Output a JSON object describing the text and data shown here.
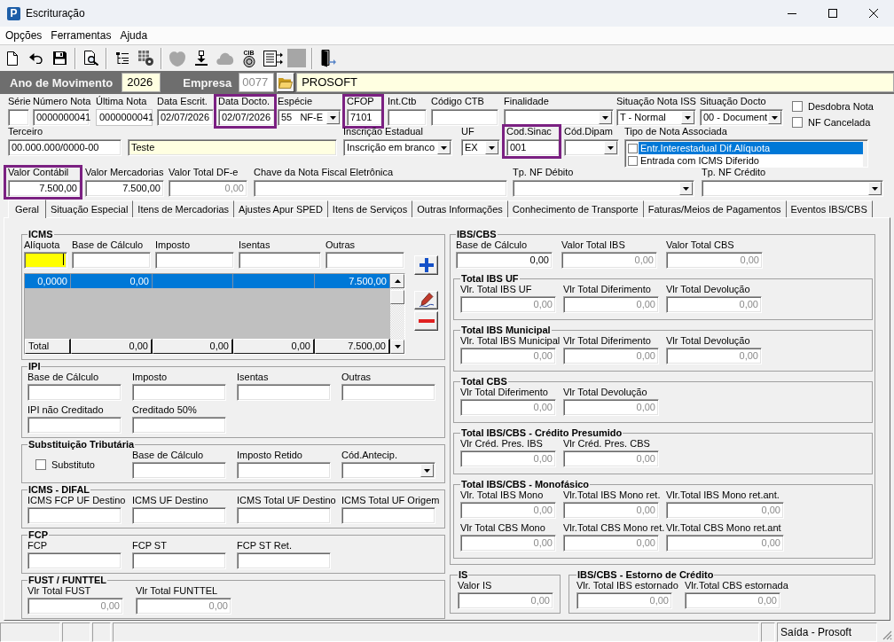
{
  "window": {
    "icon_text": "P",
    "title": "Escrituração"
  },
  "menu": [
    {
      "label": "Opções"
    },
    {
      "label": "Ferramentas"
    },
    {
      "label": "Ajuda"
    }
  ],
  "toolbar": [
    [
      {
        "disabled": false
      },
      {
        "disabled": false
      },
      {
        "disabled": false
      }
    ],
    [
      {
        "disabled": false
      }
    ],
    [
      {
        "disabled": false
      },
      {
        "disabled": false
      }
    ],
    [
      {
        "disabled": true
      },
      {
        "disabled": false
      },
      {
        "disabled": true
      },
      {
        "disabled": false,
        "caption": "CIB"
      },
      {
        "disabled": false
      },
      {
        "disabled": true
      }
    ],
    [
      {
        "disabled": false
      }
    ]
  ],
  "header": {
    "year": {
      "label": "Ano de Movimento",
      "value": "2026",
      "readonly": true
    },
    "company": {
      "label": "Empresa",
      "code": {
        "value": "0077",
        "disabled": true
      },
      "name": {
        "value": "PROSOFT",
        "readonly": true
      }
    }
  },
  "document": {
    "fields": [
      {
        "kind": "text",
        "label": "Série",
        "highlighted": false
      },
      {
        "kind": "text",
        "label": "Número Nota",
        "value": "0000000041",
        "disabled": false,
        "highlighted": false
      },
      {
        "kind": "static",
        "label": "Última Nota",
        "value": "0000000041",
        "disabled": false,
        "highlighted": false
      },
      {
        "kind": "text",
        "label": "Data Escrit.",
        "value": "02/07/2026",
        "disabled": false,
        "highlighted": false
      },
      {
        "kind": "text",
        "label": "Data Docto.",
        "value": "02/07/2026",
        "disabled": false,
        "highlighted": true
      },
      {
        "kind": "combo",
        "label": "Espécie",
        "value": "55   NF-E",
        "disabled": false,
        "highlighted": false
      },
      {
        "kind": "text",
        "label": "CFOP",
        "value": "7101",
        "disabled": false,
        "highlighted": true
      },
      {
        "kind": "text",
        "label": "Int.Ctb",
        "highlighted": false
      },
      {
        "kind": "text",
        "label": "Código CTB",
        "highlighted": false
      },
      {
        "kind": "combo",
        "label": "Finalidade",
        "highlighted": false
      },
      {
        "kind": "combo",
        "label": "Situação Nota ISS",
        "value": "T - Normal",
        "disabled": false,
        "highlighted": false
      },
      {
        "kind": "combo",
        "label": "Situação Docto",
        "value": "00 - Document",
        "disabled": false,
        "highlighted": false
      },
      {
        "kind": "checks",
        "options": [
          {
            "label": "Desdobra Nota",
            "checked": false
          },
          {
            "label": "NF Cancelada",
            "checked": false
          }
        ]
      },
      {
        "kind": "text",
        "label": "Terceiro",
        "value": "00.000.000/0000-00",
        "disabled": false,
        "highlighted": false
      },
      {
        "kind": "text",
        "value": "Teste",
        "disabled": false,
        "readonly": true,
        "highlighted": false
      },
      {
        "kind": "combo",
        "label": "Inscrição Estadual",
        "value": "Inscrição em branco",
        "disabled": false,
        "highlighted": false
      },
      {
        "kind": "combo",
        "label": "UF",
        "value": "EX",
        "disabled": false,
        "highlighted": false
      },
      {
        "kind": "text",
        "label": "Cod.Sinac",
        "value": "001",
        "disabled": false,
        "highlighted": true
      },
      {
        "kind": "combo",
        "label": "Cód.Dipam",
        "highlighted": false
      },
      {
        "kind": "checklist",
        "label": "Tipo de Nota Associada",
        "highlighted": false,
        "items": [
          {
            "label": "Entr.Interestadual Dif.Alíquota",
            "checked": false,
            "selected": true
          },
          {
            "label": "Entrada com ICMS Diferido",
            "checked": false,
            "selected": false
          }
        ]
      },
      {
        "kind": "text",
        "label": "Valor Contábil",
        "value": "7.500,00",
        "disabled": false,
        "highlighted": true
      },
      {
        "kind": "text",
        "label": "Valor Mercadorias",
        "value": "7.500,00",
        "disabled": false,
        "highlighted": false
      },
      {
        "kind": "text",
        "label": "Valor Total DF-e",
        "value": "0,00",
        "disabled": true,
        "highlighted": false
      },
      {
        "kind": "text",
        "label": "Chave da Nota Fiscal Eletrônica",
        "highlighted": false
      },
      {
        "kind": "combo",
        "label": "Tp. NF Débito",
        "highlighted": false
      },
      {
        "kind": "combo",
        "label": "Tp. NF Crédito",
        "highlighted": false
      }
    ]
  },
  "tabs": [
    {
      "label": "Geral",
      "selected": true
    },
    {
      "label": "Situação Especial",
      "selected": false
    },
    {
      "label": "Itens de Mercadorias",
      "selected": false
    },
    {
      "label": "Ajustes Apur SPED",
      "selected": false
    },
    {
      "label": "Itens de Serviços",
      "selected": false
    },
    {
      "label": "Outras Informações",
      "selected": false
    },
    {
      "label": "Conhecimento de Transporte",
      "selected": false
    },
    {
      "label": "Faturas/Meios de Pagamentos",
      "selected": false
    },
    {
      "label": "Eventos IBS/CBS",
      "selected": false
    }
  ],
  "geral": {
    "icms": {
      "title": "ICMS",
      "fields": [
        {
          "label": "Alíquota",
          "focused": true
        },
        {
          "label": "Base de Cálculo",
          "focused": false
        },
        {
          "label": "Imposto",
          "focused": false
        },
        {
          "label": "Isentas",
          "focused": false
        },
        {
          "label": "Outras",
          "focused": false
        }
      ],
      "grid": {
        "rows": [
          {
            "aliquota": "0,0000",
            "base_de_calculo": "0,00",
            "outras": "7.500,00",
            "selected": true
          }
        ],
        "total": {
          "label": "Total",
          "base_de_calculo": "0,00",
          "imposto": "0,00",
          "isentas": "0,00",
          "outras": "7.500,00"
        }
      }
    },
    "left_groups": [
      {
        "title": "IPI",
        "rows": [
          [
            {
              "label": "Base de Cálculo"
            },
            {
              "label": "Imposto"
            },
            {
              "label": "Isentas"
            },
            {
              "label": "Outras"
            }
          ],
          [
            {
              "label": "IPI não Creditado"
            },
            {
              "label": "Creditado 50%"
            }
          ]
        ]
      },
      {
        "title": "Substituição Tributária",
        "rows": [
          [
            {
              "kind": "checkbox",
              "label": "Substituto",
              "checked": false
            },
            {
              "kind": "text",
              "label": "Base de Cálculo"
            },
            {
              "kind": "text",
              "label": "Imposto Retido"
            },
            {
              "kind": "combo",
              "label": "Cód.Antecip."
            }
          ]
        ]
      },
      {
        "title": "ICMS - DIFAL",
        "rows": [
          [
            {
              "label": "ICMS FCP UF Destino"
            },
            {
              "label": "ICMS UF Destino"
            },
            {
              "label": "ICMS Total UF Destino"
            },
            {
              "label": "ICMS Total UF Origem"
            }
          ]
        ]
      },
      {
        "title": "FCP",
        "rows": [
          [
            {
              "label": "FCP"
            },
            {
              "label": "FCP ST"
            },
            {
              "label": "FCP ST Ret."
            }
          ]
        ]
      },
      {
        "title": "FUST / FUNTTEL",
        "rows": [
          [
            {
              "label": "Vlr Total FUST",
              "value": "0,00",
              "disabled": true
            },
            {
              "label": "Vlr Total FUNTTEL",
              "value": "0,00",
              "disabled": true
            }
          ]
        ]
      }
    ],
    "ibs_cbs": {
      "title": "IBS/CBS",
      "fields": [
        {
          "label": "Base de Cálculo",
          "value": "0,00",
          "disabled": false
        },
        {
          "label": "Valor Total IBS",
          "value": "0,00",
          "disabled": true
        },
        {
          "label": "Valor Total CBS",
          "value": "0,00",
          "disabled": true
        }
      ],
      "groups": [
        {
          "title": "Total IBS UF",
          "rows": [
            [
              {
                "label": "Vlr. Total IBS UF",
                "value": "0,00",
                "disabled": true
              },
              {
                "label": "Vlr Total Diferimento",
                "value": "0,00",
                "disabled": true
              },
              {
                "label": "Vlr Total Devolução",
                "value": "0,00",
                "disabled": true
              }
            ]
          ]
        },
        {
          "title": "Total IBS Municipal",
          "rows": [
            [
              {
                "label": "Vlr. Total IBS Municipal",
                "value": "0,00",
                "disabled": true
              },
              {
                "label": "Vlr Total Diferimento",
                "value": "0,00",
                "disabled": true
              },
              {
                "label": "Vlr Total Devolução",
                "value": "0,00",
                "disabled": true
              }
            ]
          ]
        },
        {
          "title": "Total CBS",
          "rows": [
            [
              {
                "label": "Vlr Total Diferimento",
                "value": "0,00",
                "disabled": true
              },
              {
                "label": "Vlr Total Devolução",
                "value": "0,00",
                "disabled": true
              }
            ]
          ]
        },
        {
          "title": "Total IBS/CBS - Crédito Presumido",
          "rows": [
            [
              {
                "label": "Vlr Créd. Pres. IBS",
                "value": "0,00",
                "disabled": true
              },
              {
                "label": "Vlr Créd. Pres. CBS",
                "value": "0,00",
                "disabled": true
              }
            ]
          ]
        },
        {
          "title": "Total IBS/CBS - Monofásico",
          "rows": [
            [
              {
                "label": "Vlr. Total IBS Mono",
                "value": "0,00",
                "disabled": true
              },
              {
                "label": "Vlr.Total IBS Mono ret.",
                "value": "0,00",
                "disabled": true
              },
              {
                "label": "Vlr.Total IBS Mono ret.ant.",
                "value": "0,00",
                "disabled": true
              }
            ],
            [
              {
                "label": "Vlr Total CBS Mono",
                "value": "0,00",
                "disabled": true
              },
              {
                "label": "Vlr.Total CBS Mono ret.",
                "value": "0,00",
                "disabled": true
              },
              {
                "label": "Vlr.Total CBS Mono ret.ant",
                "value": "0,00",
                "disabled": true
              }
            ]
          ]
        }
      ]
    },
    "is": {
      "title": "IS",
      "rows": [
        [
          {
            "label": "Valor IS",
            "value": "0,00",
            "disabled": true
          }
        ]
      ]
    },
    "estorno_de_credito": {
      "title": "IBS/CBS - Estorno de Crédito",
      "rows": [
        [
          {
            "label": "Vlr. Total IBS estornado",
            "value": "0,00",
            "disabled": true
          },
          {
            "label": "Vlr.Total CBS estornada",
            "value": "0,00",
            "disabled": true
          }
        ]
      ]
    }
  },
  "status_bar": {
    "text": "Saída - Prosoft"
  }
}
